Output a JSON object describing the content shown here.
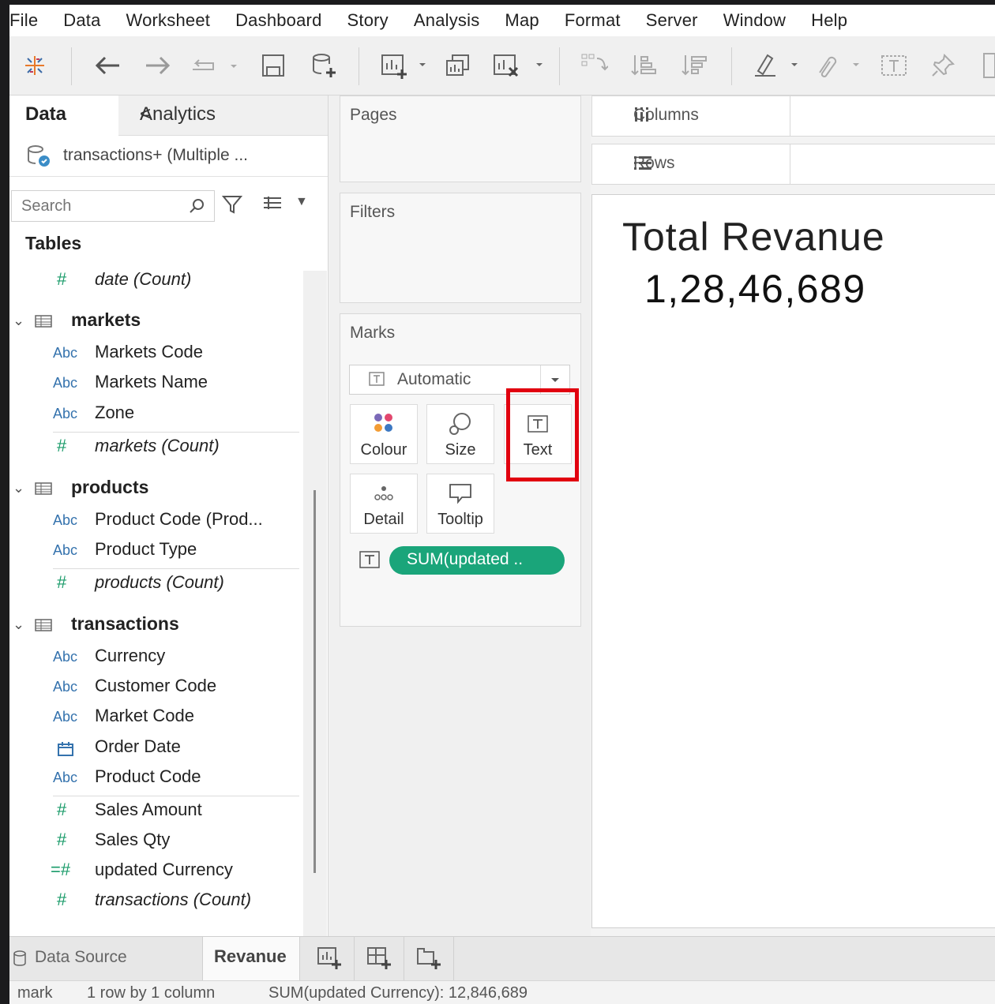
{
  "menu": [
    "File",
    "Data",
    "Worksheet",
    "Dashboard",
    "Story",
    "Analysis",
    "Map",
    "Format",
    "Server",
    "Window",
    "Help"
  ],
  "datapane": {
    "tab_data": "Data",
    "tab_analytics": "Analytics",
    "collapse_symbol": "<",
    "datasource_name": "transactions+ (Multiple ...",
    "search_placeholder": "Search",
    "tables_label": "Tables",
    "fields": {
      "date_count": "date (Count)",
      "markets": "markets",
      "markets_code": "Markets Code",
      "markets_name": "Markets Name",
      "zone": "Zone",
      "markets_count": "markets (Count)",
      "products": "products",
      "product_code_prod": "Product Code (Prod...",
      "product_type": "Product Type",
      "products_count": "products (Count)",
      "transactions": "transactions",
      "currency": "Currency",
      "customer_code": "Customer Code",
      "market_code": "Market Code",
      "order_date": "Order Date",
      "product_code": "Product Code",
      "sales_amount": "Sales Amount",
      "sales_qty": "Sales Qty",
      "updated_currency": "updated Currency",
      "transactions_count": "transactions (Count)"
    },
    "type_abc": "Abc",
    "type_measure": "#"
  },
  "shelves": {
    "pages": "Pages",
    "filters": "Filters",
    "marks": "Marks",
    "columns": "Columns",
    "rows": "Rows"
  },
  "marks_card": {
    "mark_type": "Automatic",
    "colour": "Colour",
    "size": "Size",
    "text": "Text",
    "detail": "Detail",
    "tooltip": "Tooltip",
    "pill": "SUM(updated .."
  },
  "view": {
    "title": "Total Revanue",
    "value": "1,28,46,689"
  },
  "bottom": {
    "data_source": "Data Source",
    "sheet": "Revanue"
  },
  "status": {
    "marks": "mark",
    "dims": "1 row  by  1 column",
    "sum": "SUM(updated Currency): 12,846,689"
  },
  "colors": {
    "highlight": "#e1000f",
    "pill": "#1aa57a",
    "dimension_type": "#3472ad",
    "measure_type": "#1a9b6a"
  }
}
